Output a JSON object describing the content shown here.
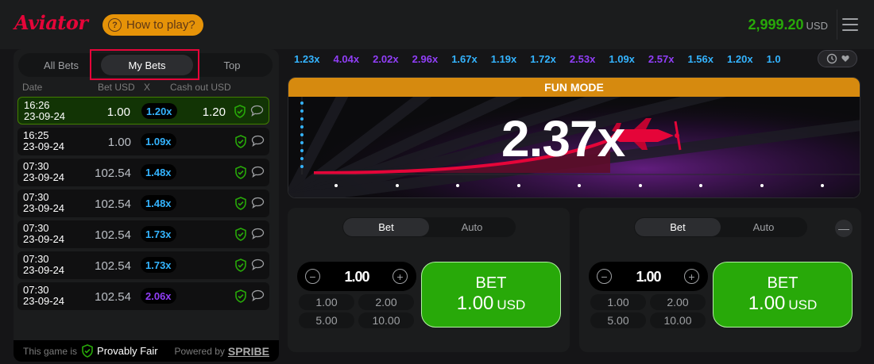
{
  "header": {
    "logo": "Aviator",
    "how_to_play": "How to play?",
    "balance": "2,999.20",
    "currency": "USD"
  },
  "bets_panel": {
    "tabs": [
      "All Bets",
      "My Bets",
      "Top"
    ],
    "active_tab": "My Bets",
    "columns": {
      "date": "Date",
      "bet": "Bet USD",
      "x": "X",
      "cashout": "Cash out USD"
    },
    "rows": [
      {
        "time": "16:26",
        "date": "23-09-24",
        "bet": "1.00",
        "mult": "1.20x",
        "cashout": "1.20",
        "win": true,
        "color": "blue"
      },
      {
        "time": "16:25",
        "date": "23-09-24",
        "bet": "1.00",
        "mult": "1.09x",
        "cashout": "",
        "win": false,
        "color": "blue"
      },
      {
        "time": "07:30",
        "date": "23-09-24",
        "bet": "102.54",
        "mult": "1.48x",
        "cashout": "",
        "win": false,
        "color": "blue"
      },
      {
        "time": "07:30",
        "date": "23-09-24",
        "bet": "102.54",
        "mult": "1.48x",
        "cashout": "",
        "win": false,
        "color": "blue"
      },
      {
        "time": "07:30",
        "date": "23-09-24",
        "bet": "102.54",
        "mult": "1.73x",
        "cashout": "",
        "win": false,
        "color": "blue"
      },
      {
        "time": "07:30",
        "date": "23-09-24",
        "bet": "102.54",
        "mult": "1.73x",
        "cashout": "",
        "win": false,
        "color": "blue"
      },
      {
        "time": "07:30",
        "date": "23-09-24",
        "bet": "102.54",
        "mult": "2.06x",
        "cashout": "",
        "win": false,
        "color": "purple"
      }
    ],
    "footer": {
      "this_game_is": "This game is",
      "provably_fair": "Provably Fair",
      "powered_by": "Powered by",
      "spribe": "SPRIBE"
    }
  },
  "history": [
    {
      "v": "1.23x",
      "c": "blue"
    },
    {
      "v": "4.04x",
      "c": "purple"
    },
    {
      "v": "2.02x",
      "c": "purple"
    },
    {
      "v": "2.96x",
      "c": "purple"
    },
    {
      "v": "1.67x",
      "c": "blue"
    },
    {
      "v": "1.19x",
      "c": "blue"
    },
    {
      "v": "1.72x",
      "c": "blue"
    },
    {
      "v": "2.53x",
      "c": "purple"
    },
    {
      "v": "1.09x",
      "c": "blue"
    },
    {
      "v": "2.57x",
      "c": "purple"
    },
    {
      "v": "1.56x",
      "c": "blue"
    },
    {
      "v": "1.20x",
      "c": "blue"
    },
    {
      "v": "1.0",
      "c": "blue"
    }
  ],
  "game": {
    "mode_label": "FUN MODE",
    "multiplier": "2.37x"
  },
  "bet_panels": [
    {
      "tabs": [
        "Bet",
        "Auto"
      ],
      "amount": "1.00",
      "quick": [
        "1.00",
        "2.00",
        "5.00",
        "10.00"
      ],
      "button_line1": "BET",
      "button_amount": "1.00",
      "button_currency": "USD"
    },
    {
      "tabs": [
        "Bet",
        "Auto"
      ],
      "amount": "1.00",
      "quick": [
        "1.00",
        "2.00",
        "5.00",
        "10.00"
      ],
      "button_line1": "BET",
      "button_amount": "1.00",
      "button_currency": "USD"
    }
  ],
  "colors": {
    "brand_red": "#e50539",
    "win_green": "#28a909",
    "mult_blue": "#34b4ff",
    "mult_purple": "#913ef8",
    "fun_mode_orange": "#d68a0f"
  }
}
